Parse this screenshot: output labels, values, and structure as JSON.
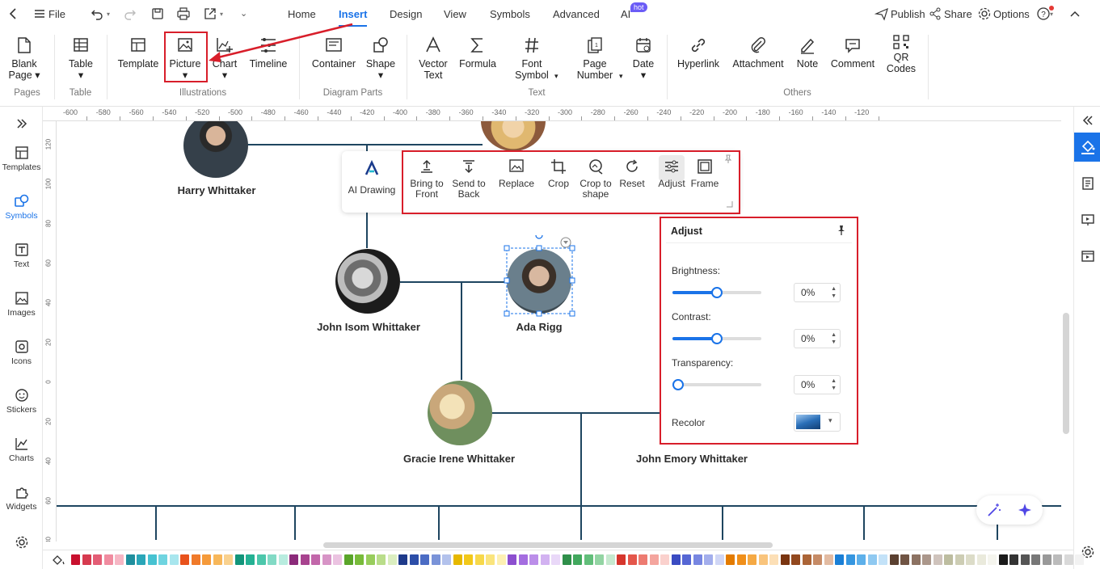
{
  "topbar": {
    "file_label": "File",
    "tabs": [
      "Home",
      "Insert",
      "Design",
      "View",
      "Symbols",
      "Advanced",
      "AI"
    ],
    "active_tab": "Insert",
    "ai_badge": "hot",
    "publish_label": "Publish",
    "share_label": "Share",
    "options_label": "Options"
  },
  "ribbon": {
    "buttons": {
      "blank_page": "Blank Page",
      "table": "Table",
      "template": "Template",
      "picture": "Picture",
      "chart": "Chart",
      "timeline": "Timeline",
      "container": "Container",
      "shape": "Shape",
      "vector_text": "Vector Text",
      "formula": "Formula",
      "font_symbol": "Font Symbol",
      "page_number": "Page Number",
      "date": "Date",
      "hyperlink": "Hyperlink",
      "attachment": "Attachment",
      "note": "Note",
      "comment": "Comment",
      "qr_codes": "QR Codes"
    },
    "groups": {
      "pages": "Pages",
      "table": "Table",
      "illustrations": "Illustrations",
      "diagram_parts": "Diagram Parts",
      "text": "Text",
      "others": "Others"
    }
  },
  "leftbar": {
    "templates": "Templates",
    "symbols": "Symbols",
    "text": "Text",
    "images": "Images",
    "icons": "Icons",
    "stickers": "Stickers",
    "charts": "Charts",
    "widgets": "Widgets"
  },
  "ruler": {
    "h_ticks": [
      "-600",
      "-580",
      "-560",
      "-540",
      "-520",
      "-500",
      "-480",
      "-460",
      "-440",
      "-420",
      "-400",
      "-380",
      "-360",
      "-340",
      "-320",
      "-300",
      "-280",
      "-260",
      "-240",
      "-220",
      "-200",
      "-180",
      "-160",
      "-140",
      "-120"
    ],
    "v_ticks": [
      "120",
      "100",
      "80",
      "60",
      "40",
      "20",
      "0",
      "20",
      "40",
      "60",
      "80"
    ]
  },
  "tree": {
    "harry": "Harry Whittaker",
    "john_isom": "John Isom Whittaker",
    "ada": "Ada Rigg",
    "gracie": "Gracie Irene Whittaker",
    "john_emory": "John Emory Whittaker"
  },
  "floatbar": {
    "ai_drawing": "AI Drawing",
    "bring_front": "Bring to Front",
    "send_back": "Send to Back",
    "replace": "Replace",
    "crop": "Crop",
    "crop_shape": "Crop to shape",
    "reset": "Reset",
    "adjust": "Adjust",
    "frame": "Frame"
  },
  "adjust_panel": {
    "title": "Adjust",
    "brightness_label": "Brightness:",
    "brightness_value": "0%",
    "brightness_level": 0.5,
    "contrast_label": "Contrast:",
    "contrast_value": "0%",
    "contrast_level": 0.5,
    "transparency_label": "Transparency:",
    "transparency_value": "0%",
    "transparency_level": 0,
    "recolor_label": "Recolor"
  },
  "palette_colors": [
    "#c8102e",
    "#d63a4f",
    "#e35d75",
    "#f08ca0",
    "#f6b6c4",
    "#1f8f9e",
    "#2aa6b8",
    "#46c2d1",
    "#6fd4e0",
    "#a8e6ee",
    "#e8521c",
    "#f07a2a",
    "#f59a3a",
    "#f7b75a",
    "#f9d18e",
    "#12957a",
    "#24b193",
    "#4cc7ab",
    "#82dac5",
    "#b8ecdf",
    "#8b2a7a",
    "#a8438f",
    "#c267aa",
    "#d794c6",
    "#ebc3e1",
    "#5aa52a",
    "#78bb3a",
    "#98cd5c",
    "#b9dd8a",
    "#dbeec0",
    "#1e3a8a",
    "#2c4ea8",
    "#4b6cc4",
    "#7a93d8",
    "#b3c2ec",
    "#e6b800",
    "#f2c81a",
    "#f7d84a",
    "#fae47c",
    "#fdf0b3",
    "#8c4fcf",
    "#a46de0",
    "#bb8ee9",
    "#d2b2f1",
    "#e9d8f8",
    "#2f8f4a",
    "#41a85d",
    "#62be7a",
    "#93d4a3",
    "#c6e9cf",
    "#d6362d",
    "#e4564b",
    "#ed7b71",
    "#f4a59e",
    "#fad1cd",
    "#3a4bc2",
    "#5566d4",
    "#7786e1",
    "#a3aeec",
    "#d0d6f5",
    "#e37b00",
    "#f08f1a",
    "#f5a944",
    "#f9c47c",
    "#fcdfb6",
    "#7a3510",
    "#92481e",
    "#ab6436",
    "#c68b66",
    "#e2bba2",
    "#1a7fd6",
    "#3596e0",
    "#5db0ea",
    "#8fc9f1",
    "#c3e2f8",
    "#5a4030",
    "#705444",
    "#8c7262",
    "#ab978b",
    "#cfc3bc",
    "#bdbda0",
    "#cdcdb4",
    "#dcdcc8",
    "#eaeadc",
    "#f5f5ee",
    "#1a1a1a",
    "#333333",
    "#555555",
    "#777777",
    "#999999",
    "#bbbbbb",
    "#d9d9d9",
    "#f2f2f2"
  ]
}
